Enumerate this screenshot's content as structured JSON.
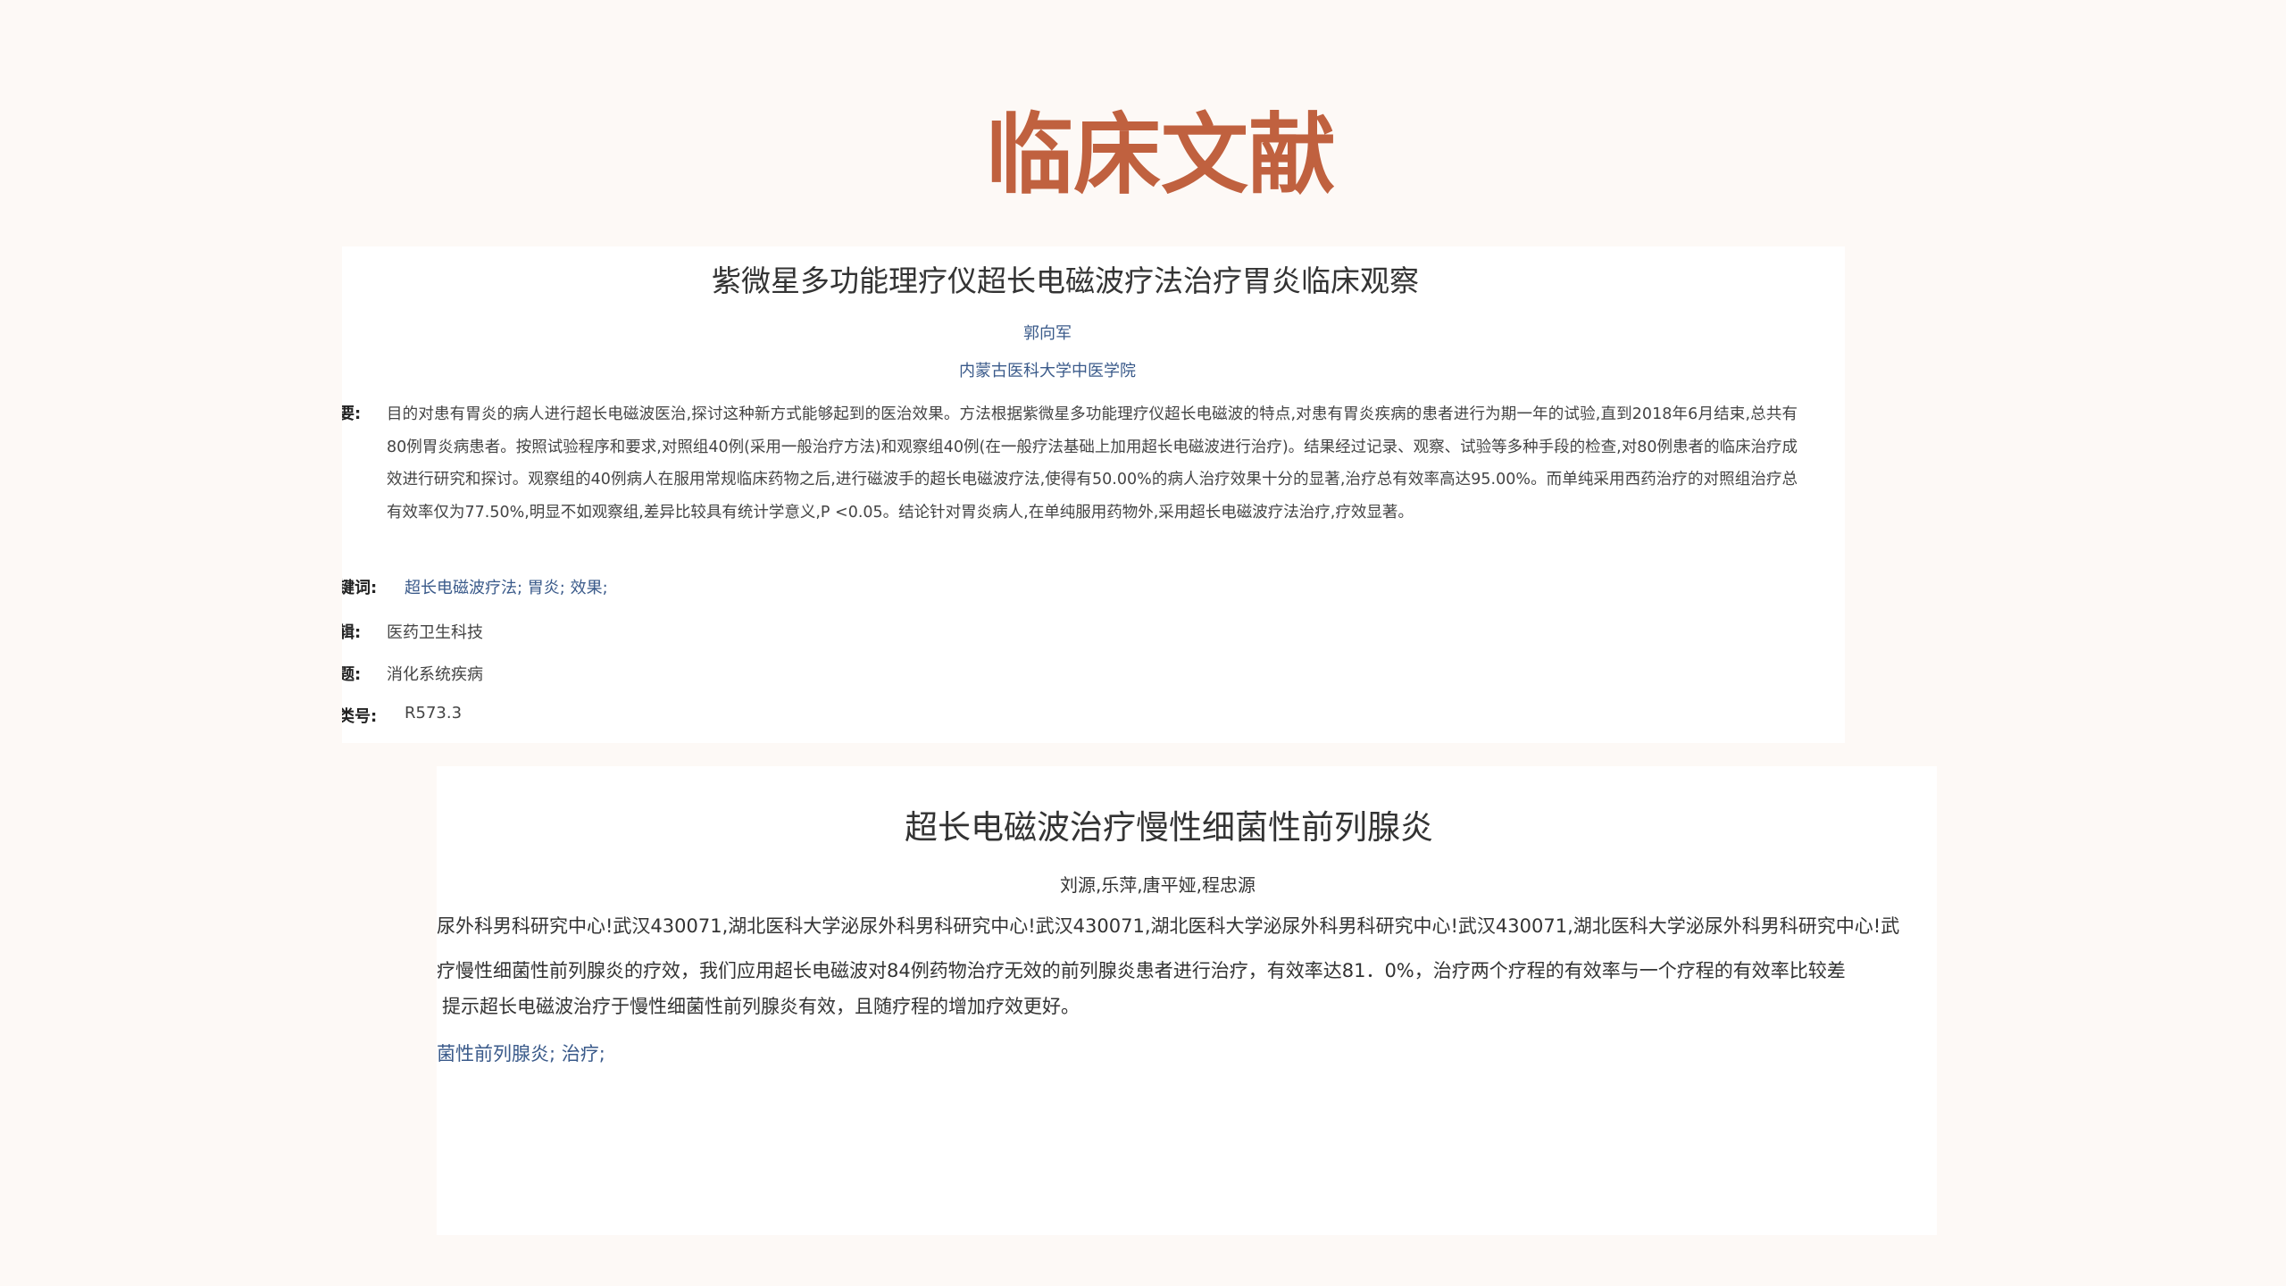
{
  "slide": {
    "title": "临床文献"
  },
  "paper1": {
    "title": "紫微星多功能理疗仪超长电磁波疗法治疗胃炎临床观察",
    "author": "郭向军",
    "affiliation": "内蒙古医科大学中医学院",
    "abstract_label": "要:",
    "abstract": "目的对患有胃炎的病人进行超长电磁波医治,探讨这种新方式能够起到的医治效果。方法根据紫微星多功能理疗仪超长电磁波的特点,对患有胃炎疾病的患者进行为期一年的试验,直到2018年6月结束,总共有80例胃炎病患者。按照试验程序和要求,对照组40例(采用一般治疗方法)和观察组40例(在一般疗法基础上加用超长电磁波进行治疗)。结果经过记录、观察、试验等多种手段的检查,对80例患者的临床治疗成效进行研究和探讨。观察组的40例病人在服用常规临床药物之后,进行磁波手的超长电磁波疗法,使得有50.00%的病人治疗效果十分的显著,治疗总有效率高达95.00%。而单纯采用西药治疗的对照组治疗总有效率仅为77.50%,明显不如观察组,差异比较具有统计学意义,P <0.05。结论针对胃炎病人,在单纯服用药物外,采用超长电磁波疗法治疗,疗效显著。",
    "keywords_label": "键词:",
    "keywords": "超长电磁波疗法;  胃炎;  效果;",
    "series_label": "辑:",
    "series": "医药卫生科技",
    "topic_label": "题:",
    "topic": "消化系统疾病",
    "class_label": "类号:",
    "class_no": "R573.3"
  },
  "paper2": {
    "title": "超长电磁波治疗慢性细菌性前列腺炎",
    "authors": "刘源,乐萍,唐平娅,程忠源",
    "affiliation": "尿外科男科研究中心!武汉430071,湖北医科大学泌尿外科男科研究中心!武汉430071,湖北医科大学泌尿外科男科研究中心!武汉430071,湖北医科大学泌尿外科男科研究中心!武",
    "abstract_line1": "疗慢性细菌性前列腺炎的疗效，我们应用超长电磁波对84例药物治疗无效的前列腺炎患者进行治疗，有效率达81．0%，治疗两个疗程的有效率与一个疗程的有效率比较差",
    "abstract_line2": "提示超长电磁波治疗于慢性细菌性前列腺炎有效，且随疗程的增加疗效更好。",
    "keywords": "菌性前列腺炎;  治疗;"
  }
}
